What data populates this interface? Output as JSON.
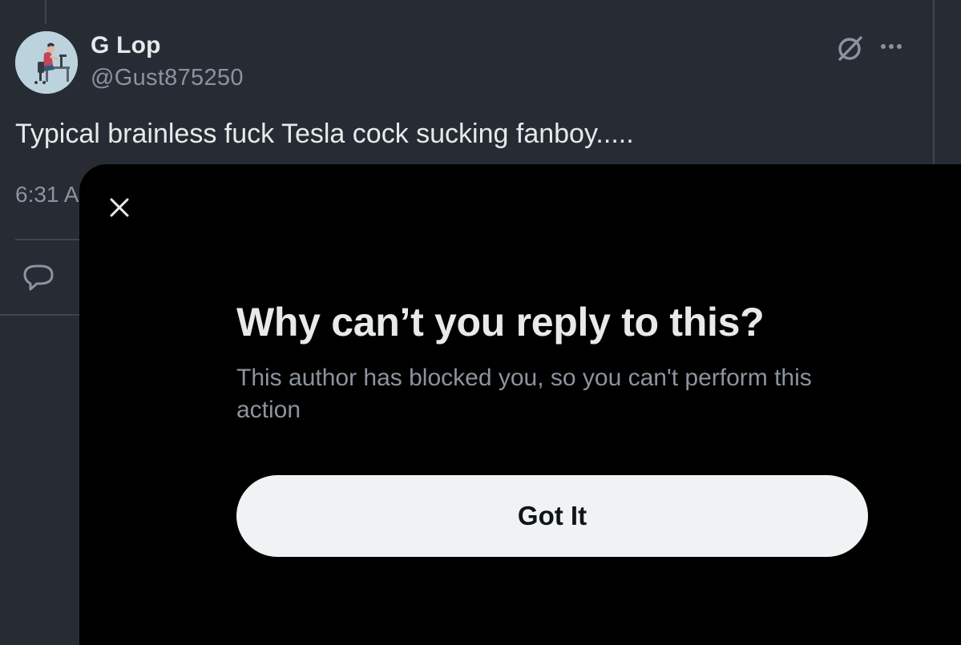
{
  "tweet": {
    "author_name": "G Lop",
    "author_handle": "@Gust875250",
    "text": "Typical brainless fuck Tesla cock sucking fanboy.....",
    "timestamp_visible": "6:31 A",
    "icons": {
      "avatar": "avatar-illustration",
      "grok": "grok-icon",
      "more": "more-options-icon",
      "reply": "reply-icon"
    }
  },
  "modal": {
    "close_icon": "close-icon",
    "title": "Why can’t you reply to this?",
    "body": "This author has blocked you, so you can't perform this action",
    "button_label": "Got It"
  },
  "colors": {
    "background": "#272c34",
    "modal_background": "#000000",
    "primary_text": "#e7e9ea",
    "secondary_text": "#8b949e",
    "button_background": "#eff3f4",
    "button_text": "#0f1419"
  }
}
